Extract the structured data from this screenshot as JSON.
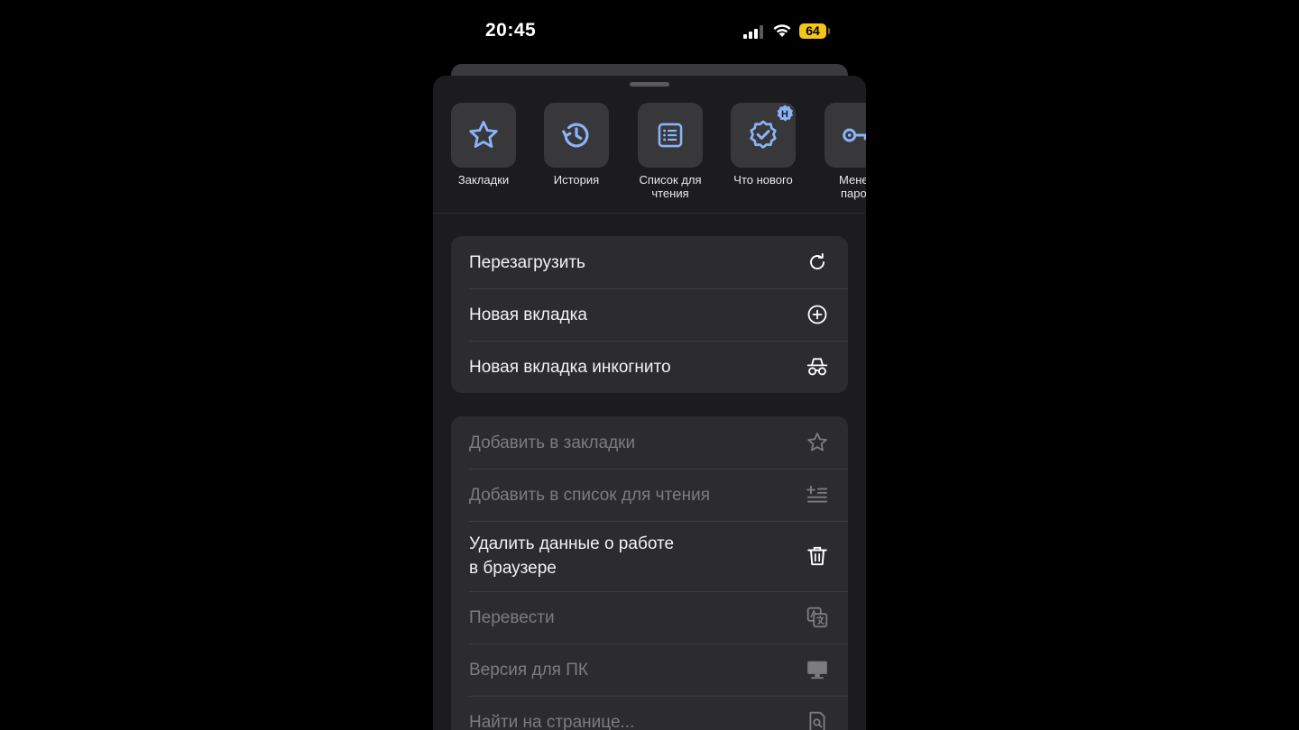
{
  "status_bar": {
    "time": "20:45",
    "battery": "64"
  },
  "quick_actions": [
    {
      "label": "Закладки",
      "icon": "star-icon"
    },
    {
      "label": "История",
      "icon": "history-icon"
    },
    {
      "label": "Список для\nчтения",
      "icon": "reading-list-icon"
    },
    {
      "label": "Что нового",
      "icon": "whats-new-icon",
      "badge": "Н"
    },
    {
      "label": "Менед\nпарол",
      "icon": "key-icon"
    }
  ],
  "menu_group_1": [
    {
      "label": "Перезагрузить",
      "icon": "reload-icon"
    },
    {
      "label": "Новая вкладка",
      "icon": "plus-circle-icon"
    },
    {
      "label": "Новая вкладка инкогнито",
      "icon": "incognito-icon"
    }
  ],
  "menu_group_2": [
    {
      "label": "Добавить в закладки",
      "icon": "star-outline-icon",
      "disabled": true
    },
    {
      "label": "Добавить в список для чтения",
      "icon": "add-reading-list-icon",
      "disabled": true
    },
    {
      "label": "Удалить данные о работе\nв браузере",
      "icon": "trash-icon",
      "disabled": false
    },
    {
      "label": "Перевести",
      "icon": "translate-icon",
      "disabled": true
    },
    {
      "label": "Версия для ПК",
      "icon": "desktop-icon",
      "disabled": true
    },
    {
      "label": "Найти на странице...",
      "icon": "find-in-page-icon",
      "disabled": true
    }
  ],
  "colors": {
    "accent": "#8ab4f8",
    "battery": "#f5c518",
    "sheet_bg": "#1c1c1e",
    "group_bg": "#2c2c2e"
  }
}
